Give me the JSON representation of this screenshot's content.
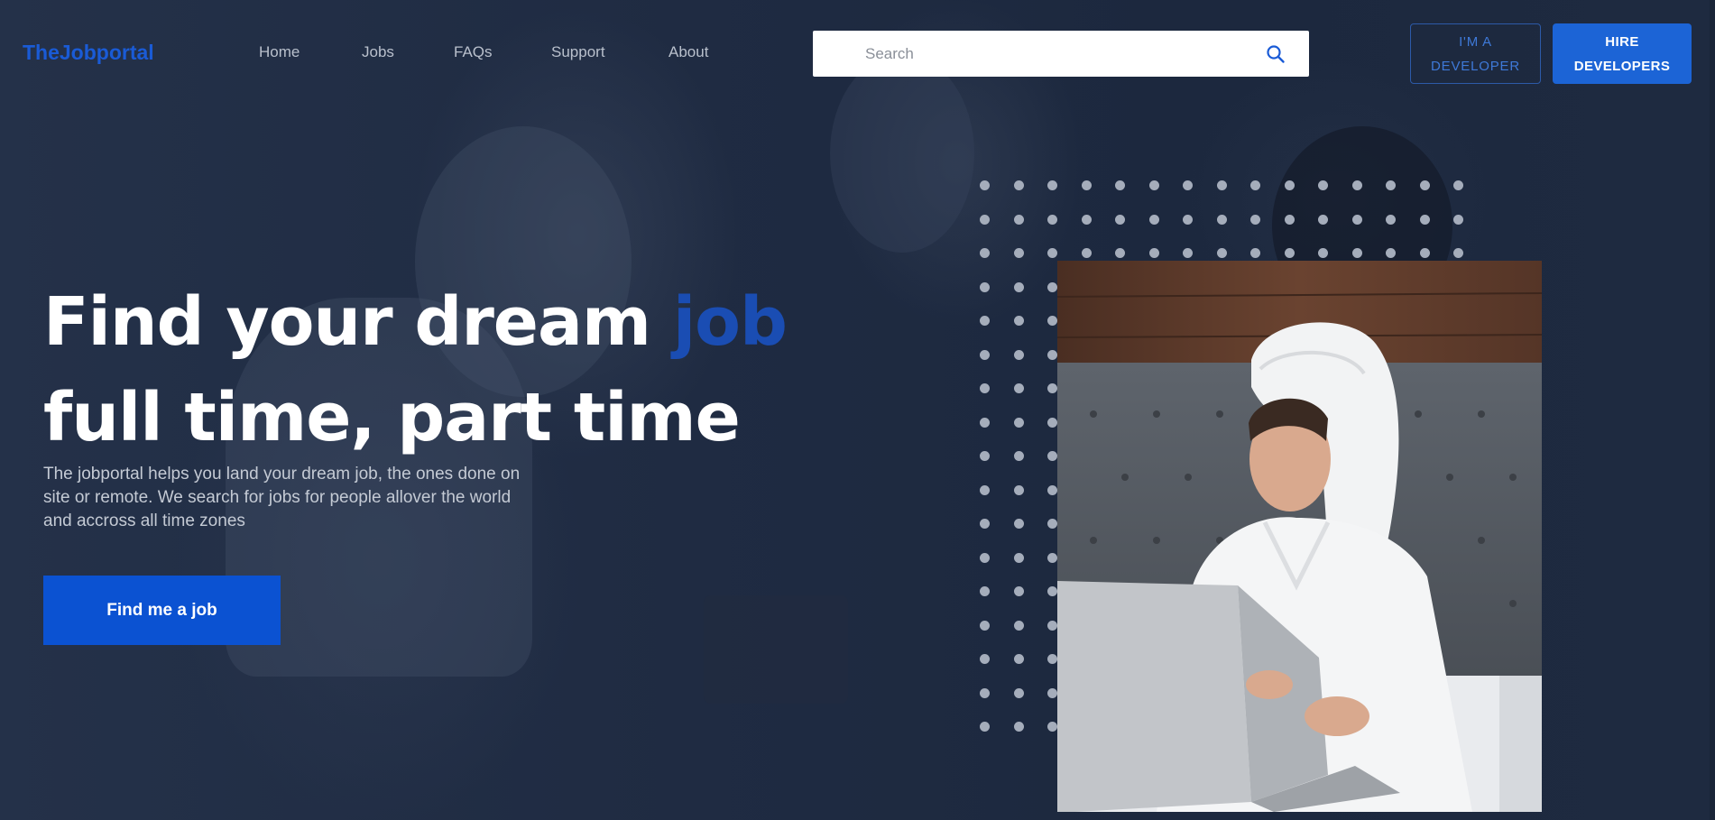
{
  "brand": {
    "name": "TheJobportal"
  },
  "nav": {
    "items": [
      {
        "label": "Home"
      },
      {
        "label": "Jobs"
      },
      {
        "label": "FAQs"
      },
      {
        "label": "Support"
      },
      {
        "label": "About"
      }
    ]
  },
  "search": {
    "placeholder": "Search",
    "value": "",
    "icon": "search-icon"
  },
  "header_buttons": {
    "developer_line1": "I'M A",
    "developer_line2": "DEVELOPER",
    "hire_line1": "HIRE",
    "hire_line2": "DEVELOPERS"
  },
  "hero": {
    "title_line1_start": "Find your dream ",
    "title_line1_accent": "job",
    "title_line2": "full time, part time",
    "subtitle_line1": "The jobportal helps you land your dream job, the ones done on",
    "subtitle_line2": "site or remote. We search for jobs for people allover the world",
    "subtitle_line3": "and accross all time zones",
    "cta_label": "Find me a job"
  },
  "colors": {
    "background": "#1e2a40",
    "brand": "#1a5bd6",
    "accent": "#1a4db3",
    "cta": "#0b52d2",
    "hire_button": "#1c64d6"
  }
}
